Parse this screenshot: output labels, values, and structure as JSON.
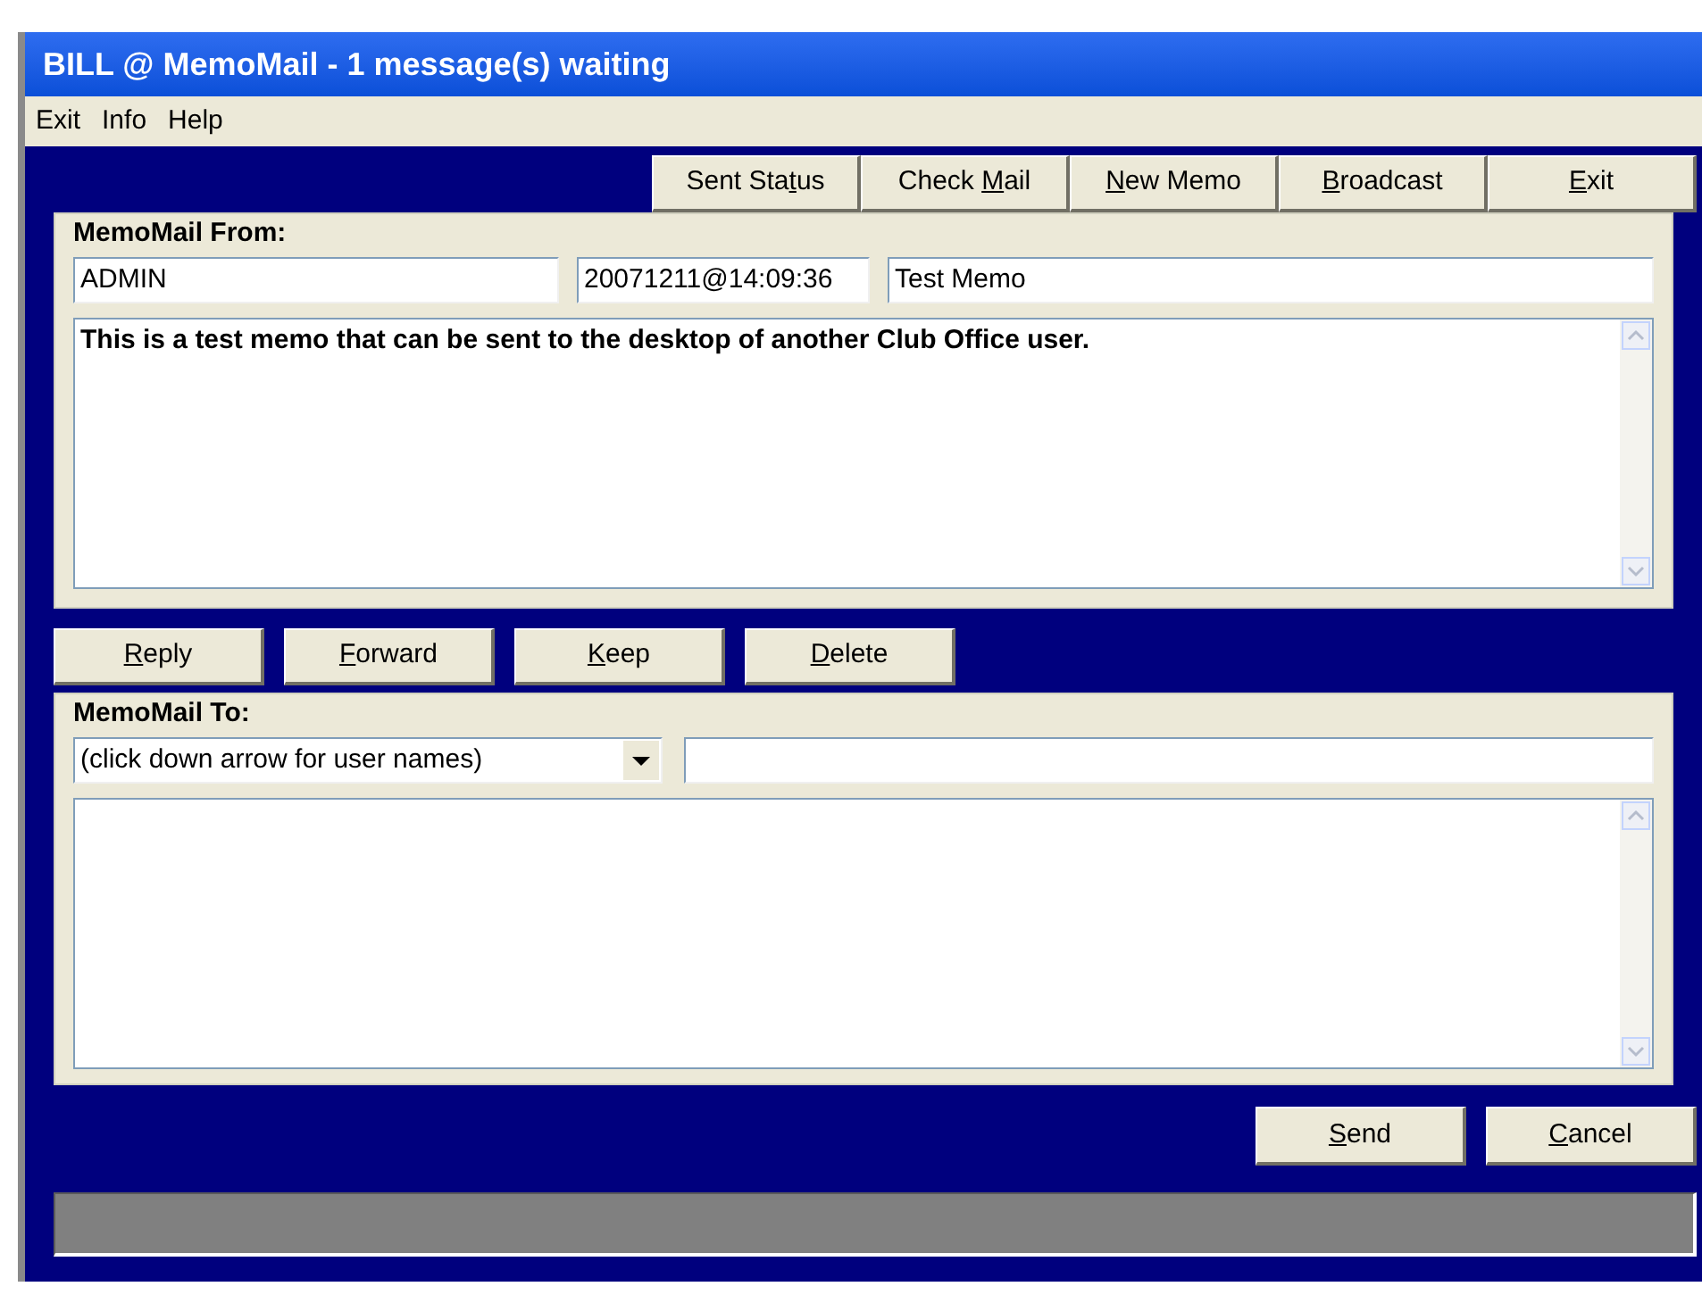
{
  "window": {
    "title": "BILL @ MemoMail - 1 message(s) waiting"
  },
  "menu": [
    "Exit",
    "Info",
    "Help"
  ],
  "toolbar": [
    {
      "pre": "Sent Sta",
      "key": "t",
      "post": "us"
    },
    {
      "pre": "Check ",
      "key": "M",
      "post": "ail"
    },
    {
      "key": "N",
      "post": "ew Memo"
    },
    {
      "key": "B",
      "post": "roadcast"
    },
    {
      "key": "E",
      "post": "xit"
    }
  ],
  "from_panel": {
    "legend": "MemoMail From:",
    "sender": "ADMIN",
    "timestamp": "20071211@14:09:36",
    "subject": "Test Memo",
    "message": "This is a test memo that can be sent to the desktop of another Club Office user."
  },
  "actions": [
    {
      "key": "R",
      "post": "eply"
    },
    {
      "key": "F",
      "post": "orward"
    },
    {
      "key": "K",
      "post": "eep"
    },
    {
      "key": "D",
      "post": "elete"
    }
  ],
  "to_panel": {
    "legend": "MemoMail To:",
    "recipient": "(click down arrow for user names)"
  },
  "footer_buttons": [
    {
      "key": "S",
      "post": "end"
    },
    {
      "key": "C",
      "post": "ancel"
    }
  ]
}
